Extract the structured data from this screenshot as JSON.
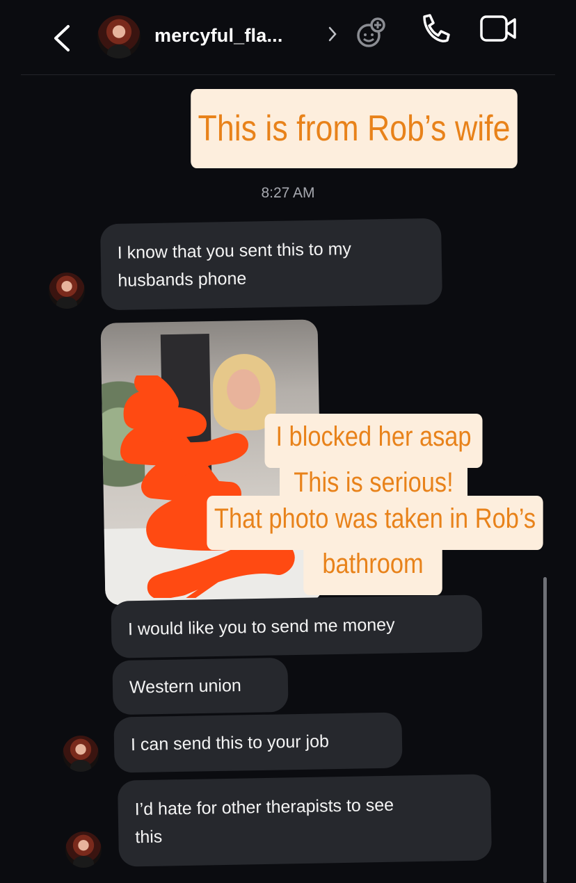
{
  "header": {
    "username": "mercyful_fla...",
    "back_icon": "chevron-left-icon",
    "profile_chevron_icon": "chevron-right-icon",
    "sticker_icon": "add-sticker-icon",
    "call_icon": "phone-icon",
    "video_icon": "video-camera-icon"
  },
  "overlay_captions": {
    "top": "This is from Rob’s wife",
    "middle_lines": [
      "I blocked her asap",
      "This is serious!",
      "That photo was taken in Rob’s",
      "bathroom"
    ]
  },
  "timestamp": "8:27 AM",
  "messages": [
    {
      "text_line1": "I know that you sent this to my",
      "text_line2": "husbands phone"
    },
    {
      "text": "I would like you to send me money"
    },
    {
      "text": "Western union"
    },
    {
      "text": "I can send this to your job"
    },
    {
      "text_line1": "I’d hate for other therapists to see",
      "text_line2": "this"
    }
  ],
  "colors": {
    "background": "#0b0c10",
    "bubble": "#26282d",
    "caption_bg": "#fdeedd",
    "caption_text": "#e8821a",
    "scribble": "#ff4a12"
  }
}
